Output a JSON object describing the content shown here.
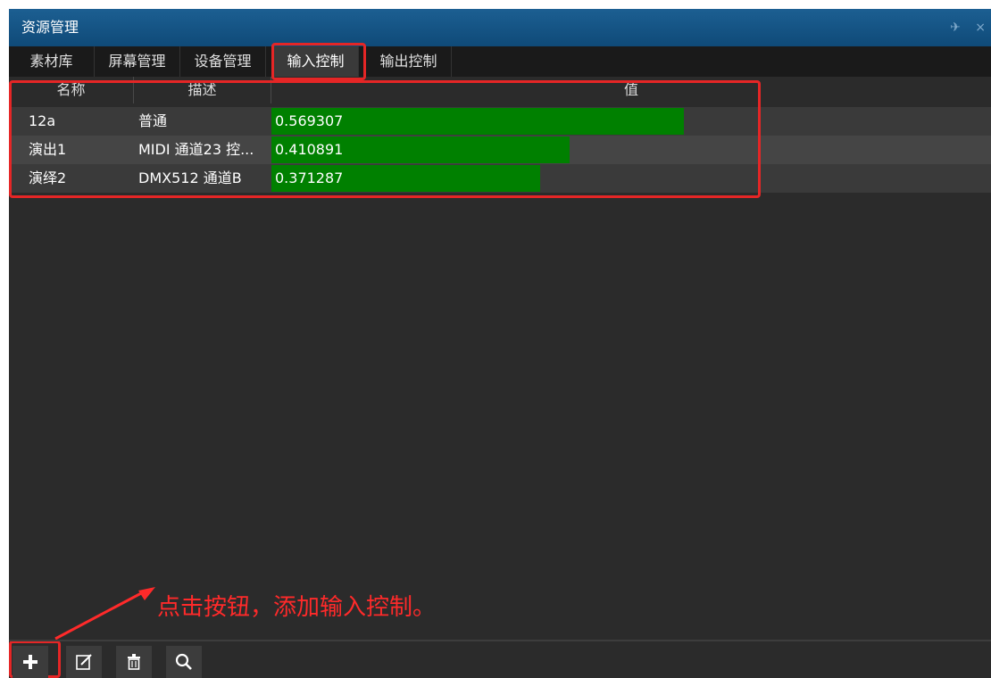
{
  "window": {
    "title": "资源管理",
    "titlebar_icons": [
      "pin-icon",
      "close-icon"
    ],
    "pin_glyph": "✈",
    "close_glyph": "×"
  },
  "tabs": [
    {
      "label": "素材库",
      "active": false
    },
    {
      "label": "屏幕管理",
      "active": false
    },
    {
      "label": "设备管理",
      "active": false
    },
    {
      "label": "输入控制",
      "active": true
    },
    {
      "label": "输出控制",
      "active": false
    }
  ],
  "grid": {
    "columns": [
      "名称",
      "描述",
      "值"
    ],
    "rows": [
      {
        "name": "12a",
        "description": "普通",
        "value": "0.569307",
        "level": 0.569307
      },
      {
        "name": "演出1",
        "description": "MIDI 通道23 控...",
        "value": "0.410891",
        "level": 0.410891
      },
      {
        "name": "演绎2",
        "description": "DMX512 通道B",
        "value": "0.371287",
        "level": 0.371287
      }
    ]
  },
  "annotation": {
    "text": "点击按钮，添加输入控制。",
    "color": "#ff2a2a"
  },
  "toolbar": {
    "buttons": [
      "add-icon",
      "edit-icon",
      "delete-icon",
      "search-icon"
    ]
  },
  "colors": {
    "titlebar": "#1c5f92",
    "bar_fill": "#008000",
    "background": "#2b2b2b",
    "annotation_border": "#e52626"
  }
}
